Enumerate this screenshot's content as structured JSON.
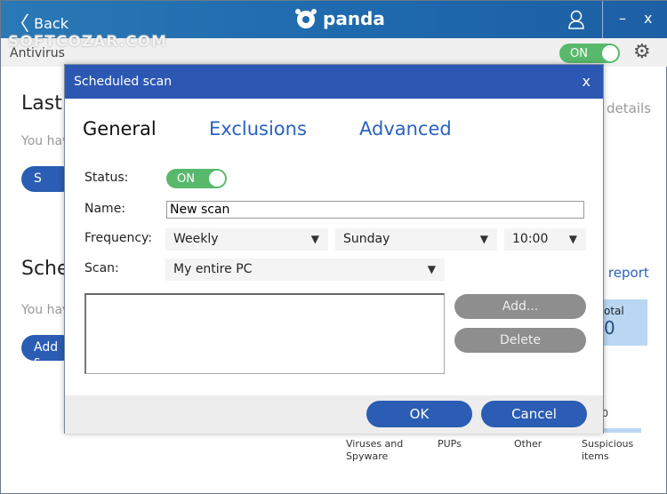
{
  "topbar": {
    "back_label": "Back",
    "logo_text": "panda",
    "minimize": "–",
    "close": "x"
  },
  "watermark": "SOFTCOZAR.COM",
  "antivirus_bar": {
    "label": "Antivirus",
    "toggle": "ON"
  },
  "background": {
    "last_heading": "Last",
    "last_text": "You hav",
    "last_button": "S",
    "details_link": "details",
    "scheduled_heading": "Sche",
    "scheduled_text": "You hav",
    "add_button": "Add s",
    "report_link": "l report",
    "total_label": "otal",
    "total_value": "0",
    "chart_tick": "0",
    "categories": [
      "Viruses and Spyware",
      "PUPs",
      "Other",
      "Suspicious items"
    ]
  },
  "dialog": {
    "title": "Scheduled scan",
    "close": "x",
    "tabs": [
      {
        "label": "General",
        "active": true
      },
      {
        "label": "Exclusions"
      },
      {
        "label": "Advanced"
      }
    ],
    "status": {
      "label": "Status:",
      "value": "ON"
    },
    "name": {
      "label": "Name:",
      "value": "New scan"
    },
    "frequency": {
      "label": "Frequency:",
      "period": "Weekly",
      "day": "Sunday",
      "time": "10:00"
    },
    "scan": {
      "label": "Scan:",
      "value": "My entire PC"
    },
    "add_button": "Add...",
    "delete_button": "Delete",
    "ok_button": "OK",
    "cancel_button": "Cancel"
  },
  "colors": {
    "accent": "#2a5db3",
    "toggle_on": "#58b96c",
    "header": "#1f6aae"
  }
}
